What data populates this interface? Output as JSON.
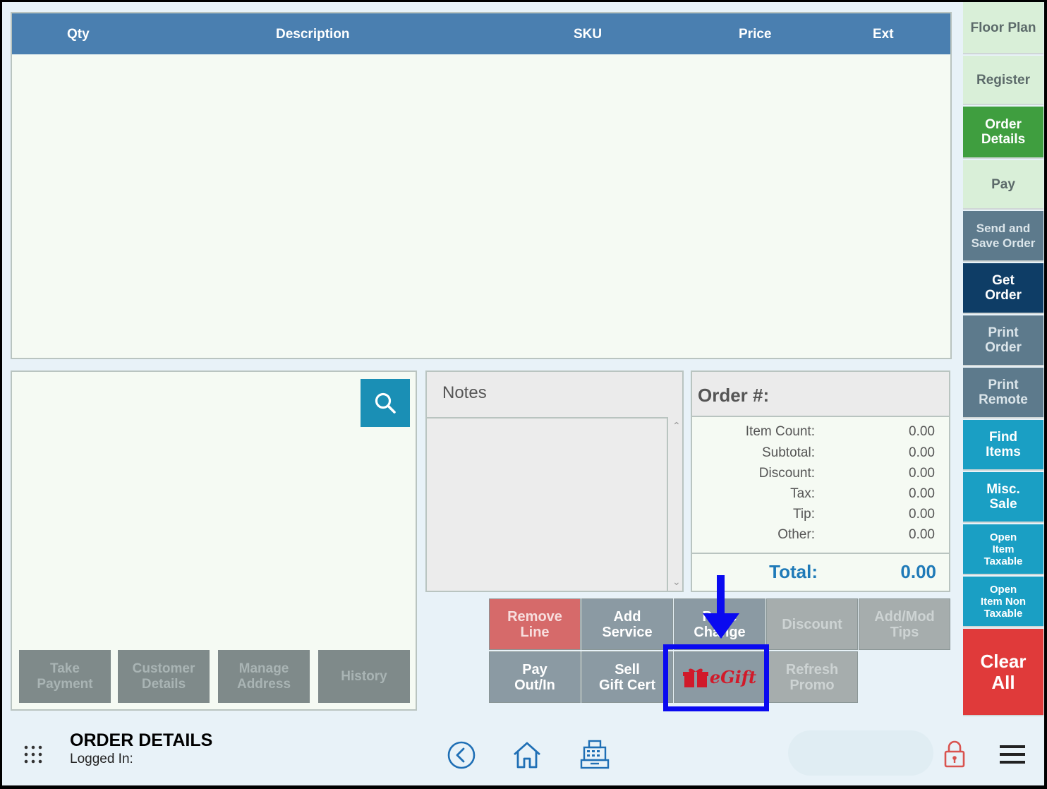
{
  "table": {
    "columns": [
      "Qty",
      "Description",
      "SKU",
      "Price",
      "Ext"
    ]
  },
  "customer": {
    "buttons": [
      "Take\nPayment",
      "Customer\nDetails",
      "Manage\nAddress",
      "History"
    ]
  },
  "notes": {
    "title": "Notes"
  },
  "summary": {
    "order_label": "Order #:",
    "rows": [
      {
        "label": "Item Count:",
        "value": "0.00"
      },
      {
        "label": "Subtotal:",
        "value": "0.00"
      },
      {
        "label": "Discount:",
        "value": "0.00"
      },
      {
        "label": "Tax:",
        "value": "0.00"
      },
      {
        "label": "Tip:",
        "value": "0.00"
      },
      {
        "label": "Other:",
        "value": "0.00"
      }
    ],
    "total_label": "Total:",
    "total_value": "0.00"
  },
  "functions": {
    "remove_line": "Remove\nLine",
    "add_service": "Add\nService",
    "price_change": "Price\nChange",
    "discount": "Discount",
    "add_mod_tips": "Add/Mod\nTips",
    "pay_out_in": "Pay\nOut/In",
    "sell_gift_cert": "Sell\nGift Cert",
    "egift": "eGift",
    "refresh_promo": "Refresh\nPromo"
  },
  "sidebar": [
    {
      "label": "Floor Plan",
      "style": "s-light"
    },
    {
      "label": "Register",
      "style": "s-light"
    },
    {
      "label": "Order\nDetails",
      "style": "s-green"
    },
    {
      "label": "Pay",
      "style": "s-light"
    },
    {
      "label": "Send and\nSave Order",
      "style": "s-slate"
    },
    {
      "label": "Get\nOrder",
      "style": "s-navy"
    },
    {
      "label": "Print\nOrder",
      "style": "s-slate"
    },
    {
      "label": "Print\nRemote",
      "style": "s-slate"
    },
    {
      "label": "Find\nItems",
      "style": "s-teal"
    },
    {
      "label": "Misc.\nSale",
      "style": "s-teal"
    },
    {
      "label": "Open\nItem\nTaxable",
      "style": "s-teal"
    },
    {
      "label": "Open\nItem Non\nTaxable",
      "style": "s-teal"
    },
    {
      "label": "Clear\nAll",
      "style": "s-red"
    }
  ],
  "bottom": {
    "title": "ORDER DETAILS",
    "logged_in": "Logged In:"
  },
  "colors": {
    "header_blue": "#4a7fb0",
    "highlight": "#0a0af0",
    "egift_red": "#d11a2a"
  }
}
